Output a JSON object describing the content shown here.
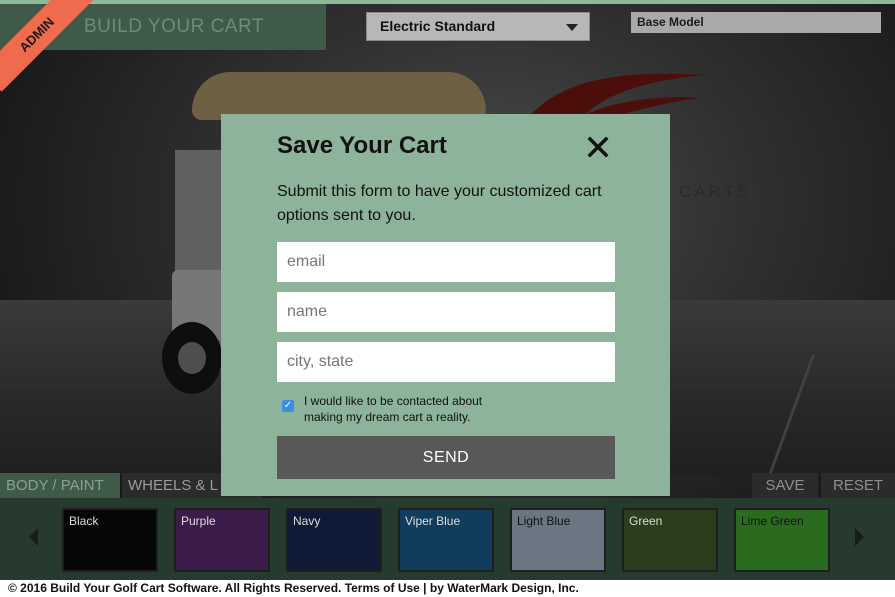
{
  "header": {
    "title": "BUILD YOUR CART",
    "admin_ribbon": "ADMIN",
    "model_select": "Electric Standard",
    "base_model": "Base Model"
  },
  "logo": {
    "text": "CARTS"
  },
  "tabs": [
    {
      "label": "BODY / PAINT"
    },
    {
      "label": "WHEELS & L"
    }
  ],
  "actions": {
    "save": "SAVE",
    "reset": "RESET"
  },
  "swatches": [
    {
      "label": "Black",
      "color": "#060606"
    },
    {
      "label": "Purple",
      "color": "#3b1b4a"
    },
    {
      "label": "Navy",
      "color": "#0f1a37"
    },
    {
      "label": "Viper Blue",
      "color": "#103d5c"
    },
    {
      "label": "Light Blue",
      "color": "#6b7683"
    },
    {
      "label": "Green",
      "color": "#2a3d1c"
    },
    {
      "label": "Lime Green",
      "color": "#2b6b1f"
    }
  ],
  "modal": {
    "title": "Save Your Cart",
    "description": "Submit this form to have your customized cart options sent to you.",
    "email_placeholder": "email",
    "name_placeholder": "name",
    "city_placeholder": "city, state",
    "checkbox_label": "I would like to be contacted about making my dream cart a reality.",
    "checkbox_checked": true,
    "send_label": "SEND"
  },
  "footer": {
    "text": "© 2016 Build Your Golf Cart Software. All Rights Reserved. Terms of Use | by WaterMark Design, Inc."
  },
  "colors": {
    "accent_green": "#8db39b",
    "admin_ribbon": "#f06a4d",
    "send_button": "#585858"
  }
}
